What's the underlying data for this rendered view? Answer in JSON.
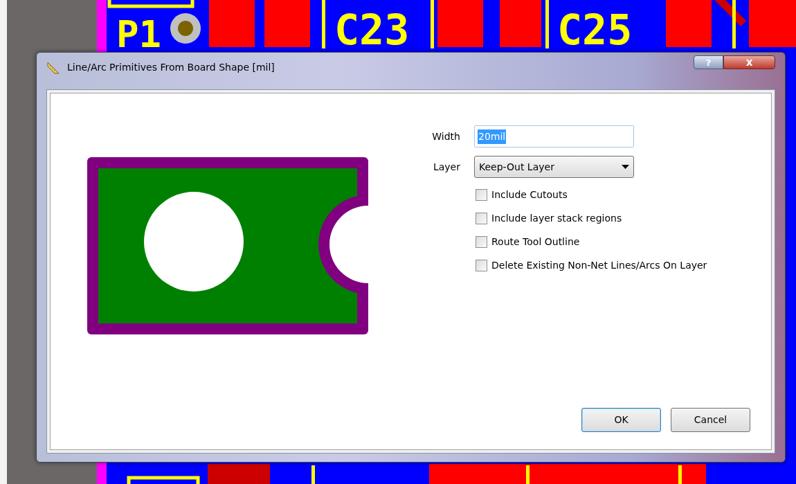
{
  "canvas": {
    "designators": [
      "P1",
      "C23",
      "C25"
    ]
  },
  "window": {
    "title": "Line/Arc Primitives From Board Shape [mil]",
    "help_button": "?",
    "close_button": "x"
  },
  "width": {
    "label": "Width",
    "value": "20mil",
    "selected": true
  },
  "layer": {
    "label": "Layer",
    "value": "Keep-Out Layer"
  },
  "options": [
    {
      "label": "Include Cutouts",
      "checked": false
    },
    {
      "label": "Include layer stack regions",
      "checked": false
    },
    {
      "label": "Route Tool Outline",
      "checked": false
    },
    {
      "label": "Delete Existing Non-Net Lines/Arcs On Layer",
      "checked": false
    }
  ],
  "buttons": [
    {
      "label": "OK",
      "kind": "default"
    },
    {
      "label": "Cancel",
      "kind": "normal"
    }
  ]
}
